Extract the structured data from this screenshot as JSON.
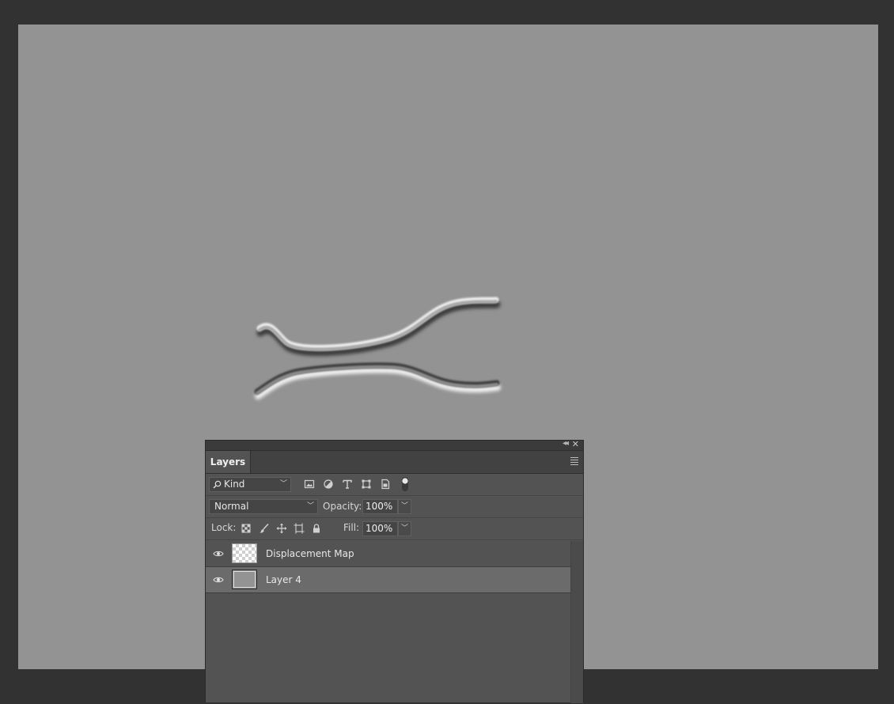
{
  "panel": {
    "tab_label": "Layers",
    "filter": {
      "kind_label": "Kind"
    },
    "blend": {
      "mode": "Normal",
      "opacity_label": "Opacity:",
      "opacity_value": "100%"
    },
    "lock": {
      "label": "Lock:",
      "fill_label": "Fill:",
      "fill_value": "100%"
    },
    "layers": [
      {
        "name": "Displacement Map",
        "visible": true,
        "selected": false,
        "thumb": "transparent-checker"
      },
      {
        "name": "Layer 4",
        "visible": true,
        "selected": true,
        "thumb": "gray-fill"
      }
    ]
  },
  "colors": {
    "app_background": "#323232",
    "canvas": "#939393",
    "panel": "#535353",
    "selected_layer": "#6b6b6b"
  },
  "icons": [
    "search-icon",
    "image-filter-icon",
    "adjustment-filter-icon",
    "type-filter-icon",
    "shape-filter-icon",
    "smart-object-filter-icon",
    "filter-toggle-icon",
    "lock-transparent-icon",
    "lock-paint-icon",
    "lock-position-icon",
    "lock-artboard-icon",
    "lock-all-icon",
    "eye-icon",
    "panel-menu-icon",
    "close-icon",
    "collapse-icon"
  ]
}
